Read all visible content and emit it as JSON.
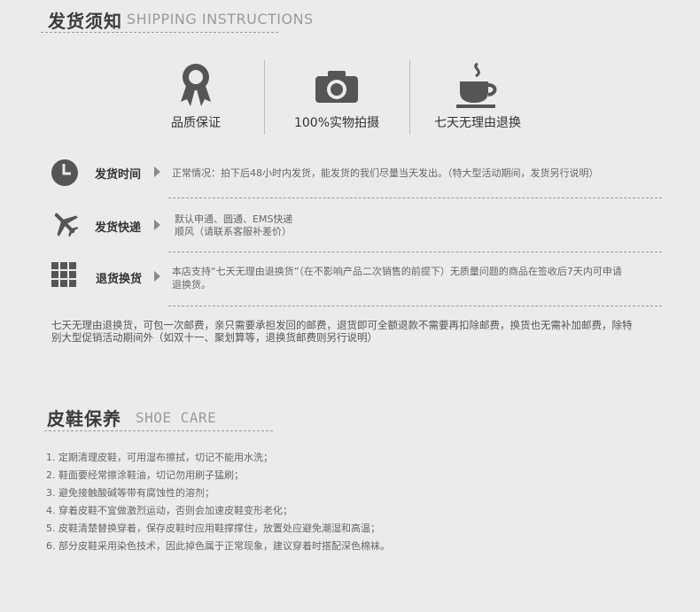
{
  "shipping": {
    "title": "发货须知",
    "subtitle": "SHIPPING INSTRUCTIONS",
    "guarantees": [
      {
        "icon": "award-ribbon-icon",
        "label": "品质保证"
      },
      {
        "icon": "camera-icon",
        "label": "100%实物拍摄"
      },
      {
        "icon": "coffee-cup-icon",
        "label": "七天无理由退换"
      }
    ],
    "rows": [
      {
        "icon": "clock-icon",
        "title": "发货时间",
        "text": "正常情况：拍下后48小时内发货，能发货的我们尽量当天发出。（特大型活动期间，发货另行说明）"
      },
      {
        "icon": "airplane-icon",
        "title": "发货快递",
        "text_line1": "默认申通、圆通、EMS快递",
        "text_line2": "顺风（请联系客服补差价）"
      },
      {
        "icon": "grid-icon",
        "title": "退货换货",
        "text_line1": "本店支持“七天无理由退换货”（在不影响产品二次销售的前提下）无质量问题的商品在签收后7天内可申请",
        "text_line2": "退换货。"
      }
    ],
    "note_line1": "七天无理由退换货，可包一次邮费，亲只需要承担发回的邮费，退货即可全额退款不需要再扣除邮费，换货也无需补加邮费，除特",
    "note_line2": "别大型促销活动期间外（如双十一、聚划算等，退换货邮费则另行说明）"
  },
  "care": {
    "title": "皮鞋保养",
    "subtitle": "SHOE CARE",
    "items": [
      "1. 定期清理皮鞋，可用湿布擦拭，切记不能用水洗；",
      "2. 鞋面要经常擦涂鞋油，切记勿用刷子猛刷；",
      "3. 避免接触酸碱等带有腐蚀性的溶剂；",
      "4. 穿着皮鞋不宜做激烈运动，否则会加速皮鞋变形老化；",
      "5. 皮鞋清楚替换穿着，保存皮鞋时应用鞋撑撑住，放置处应避免潮湿和高温；",
      "6. 部分皮鞋采用染色技术，因此掉色属于正常现象，建议穿着时搭配深色棉袜。"
    ]
  },
  "colors": {
    "background": "#ebebeb",
    "icon": "#555555",
    "dashed": "#9b9b9b"
  }
}
